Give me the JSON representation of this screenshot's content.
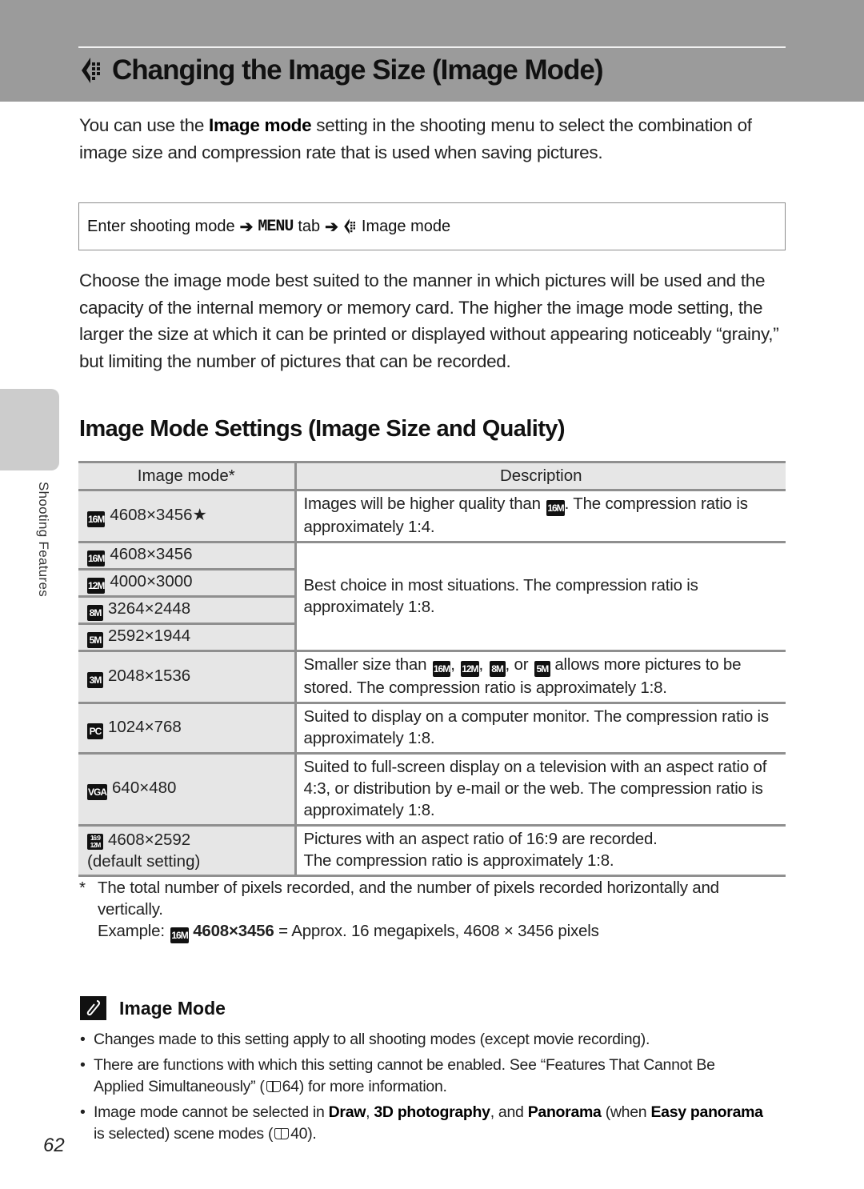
{
  "header": {
    "title": "Changing the Image Size (Image Mode)",
    "title_icon": "image-mode-icon"
  },
  "intro": {
    "pre": "You can use the ",
    "bold": "Image mode",
    "post": " setting in the shooting menu to select the combination of image size and compression rate that is used when saving pictures."
  },
  "menu_path": {
    "step1": "Enter shooting mode",
    "arrow": "➔",
    "menu_label": "MENU",
    "step2": "tab",
    "step3": "Image mode"
  },
  "choose_paragraph": "Choose the image mode best suited to the manner in which pictures will be used and the capacity of the internal memory or memory card. The higher the image mode setting, the larger the size at which it can be printed or displayed without appearing noticeably “grainy,” but limiting the number of pictures that can be recorded.",
  "section_title": "Image Mode Settings (Image Size and Quality)",
  "side_tab": {
    "label": "Shooting Features"
  },
  "table": {
    "headers": [
      "Image mode*",
      "Description"
    ],
    "rows": [
      {
        "icon": "16M★",
        "icon_name": "16m-fine-icon",
        "mode": "4608×3456",
        "suffix": "★",
        "desc_pre": "Images will be higher quality than ",
        "desc_icon": "16M",
        "desc_post": ". The compression ratio is approximately 1:4."
      },
      {
        "icon": "16M",
        "icon_name": "16m-icon",
        "mode": "4608×3456"
      },
      {
        "icon": "12M",
        "icon_name": "12m-icon",
        "mode": "4000×3000"
      },
      {
        "icon": "8M",
        "icon_name": "8m-icon",
        "mode": "3264×2448"
      },
      {
        "icon": "5M",
        "icon_name": "5m-icon",
        "mode": "2592×1944"
      },
      {
        "icon": "3M",
        "icon_name": "3m-icon",
        "mode": "2048×1536",
        "desc_pre": "Smaller size than ",
        "desc_icons": [
          "16M",
          "12M",
          "8M",
          "5M"
        ],
        "desc_sep1": ", ",
        "desc_sep2": ", ",
        "desc_sep3": ", or ",
        "desc_post": " allows more pictures to be stored. The compression ratio is approximately 1:8."
      },
      {
        "icon": "PC",
        "icon_name": "pc-icon",
        "mode": "1024×768",
        "desc": "Suited to display on a computer monitor. The compression ratio is approximately 1:8."
      },
      {
        "icon": "VGA",
        "icon_name": "vga-icon",
        "mode": "640×480",
        "desc": "Suited to full-screen display on a television with an aspect ratio of 4:3, or distribution by e-mail or the web. The compression ratio is approximately 1:8."
      },
      {
        "icon": "16:9",
        "icon_sub": "12M",
        "icon_name": "16-9-icon",
        "mode": "4608×2592",
        "mode_note": "(default setting)",
        "desc_line1": "Pictures with an aspect ratio of 16:9 are recorded.",
        "desc_line2": "The compression ratio is approximately 1:8."
      }
    ],
    "group_desc": "Best choice in most situations. The compression ratio is approximately 1:8."
  },
  "footnote": {
    "marker": "*",
    "text": "The total number of pixels recorded, and the number of pixels recorded horizontally and vertically.",
    "example_label": "Example:",
    "example_icon": "16M",
    "example_bold": "4608×3456",
    "example_rest": " = Approx. 16 megapixels, 4608 × 3456 pixels"
  },
  "note": {
    "title": "Image Mode",
    "icon": "pencil-note-icon",
    "items": [
      {
        "text": "Changes made to this setting apply to all shooting modes (except movie recording)."
      },
      {
        "pre": "There are functions with which this setting cannot be enabled. See “Features That Cannot Be Applied Simultaneously” (",
        "page": "64",
        "post": ") for more information."
      },
      {
        "pre": "Image mode cannot be selected in ",
        "b1": "Draw",
        "s1": ", ",
        "b2": "3D photography",
        "s2": ", and ",
        "b3": "Panorama",
        "s3": " (when ",
        "b4": "Easy panorama",
        "s4": " is selected) scene modes (",
        "page": "40",
        "post": ")."
      }
    ]
  },
  "page_number": "62"
}
